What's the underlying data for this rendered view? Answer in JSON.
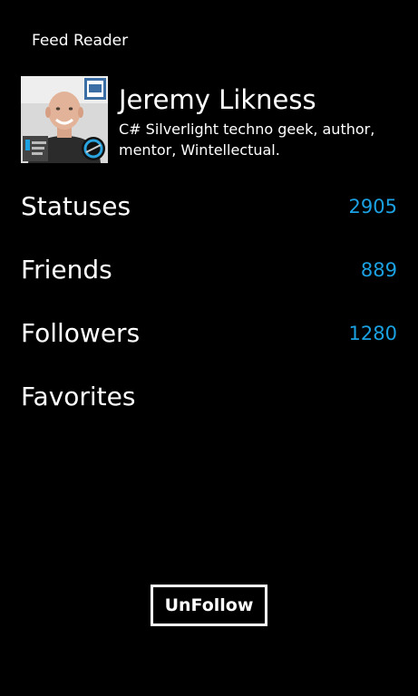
{
  "app": {
    "title": "Feed Reader"
  },
  "profile": {
    "name": "Jeremy Likness",
    "bio": "C# Silverlight techno geek, author, mentor, Wintellectual.",
    "avatar_icon": "profile-photo"
  },
  "stats": [
    {
      "label": "Statuses",
      "value": "2905"
    },
    {
      "label": "Friends",
      "value": "889"
    },
    {
      "label": "Followers",
      "value": "1280"
    },
    {
      "label": "Favorites",
      "value": ""
    }
  ],
  "actions": {
    "unfollow_label": "UnFollow"
  },
  "colors": {
    "background": "#000000",
    "text": "#ffffff",
    "accent": "#1ba1e2"
  }
}
